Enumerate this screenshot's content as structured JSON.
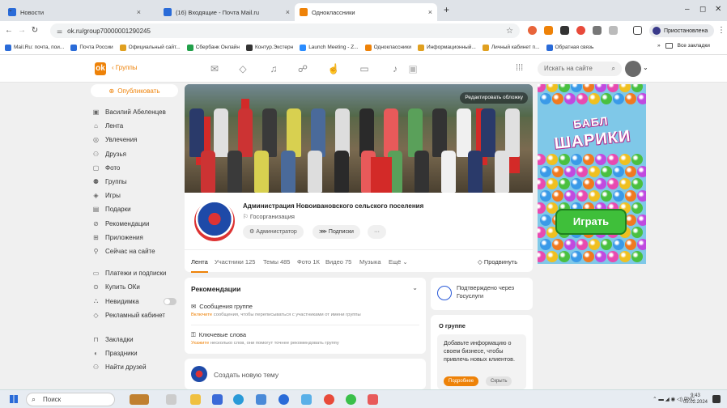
{
  "browser": {
    "tabs": [
      {
        "title": "Новости",
        "color": "#2a6bd8"
      },
      {
        "title": "(16) Входящие - Почта Mail.ru",
        "color": "#2a6bd8"
      },
      {
        "title": "Одноклассники",
        "color": "#ee8208"
      }
    ],
    "new_tab": "+",
    "url": "ok.ru/group70000001290245",
    "suspended_label": "Приостановлена",
    "bookmarks": [
      {
        "label": "Mail.Ru: почта, пои...",
        "color": "#2a6bd8"
      },
      {
        "label": "Почта России",
        "color": "#2a6bd8"
      },
      {
        "label": "Официальный сайт...",
        "color": "#e0a020"
      },
      {
        "label": "Сбербанк Онлайн",
        "color": "#22a04a"
      },
      {
        "label": "Контур.Экстерн",
        "color": "#333"
      },
      {
        "label": "Launch Meeting - Z...",
        "color": "#2a8cff"
      },
      {
        "label": "Одноклассники",
        "color": "#ee8208"
      },
      {
        "label": "Информационный...",
        "color": "#e0a020"
      },
      {
        "label": "Личный кабинет п...",
        "color": "#e0a020"
      },
      {
        "label": "Обратная связь",
        "color": "#2a6bd8"
      }
    ],
    "more_bookmarks": "»",
    "all_bookmarks": "Все закладки"
  },
  "ok_header": {
    "logo": "ok",
    "groups_link": "‹ Группы",
    "search_placeholder": "Искать на сайте"
  },
  "left_nav": {
    "publish": "Опубликовать",
    "items": [
      {
        "label": "Василий Абеленцев",
        "icon": "▣"
      },
      {
        "label": "Лента",
        "icon": "⌂"
      },
      {
        "label": "Увлечения",
        "icon": "◎"
      },
      {
        "label": "Друзья",
        "icon": "⚇"
      },
      {
        "label": "Фото",
        "icon": "▢"
      },
      {
        "label": "Группы",
        "icon": "⚉"
      },
      {
        "label": "Игры",
        "icon": "◈"
      },
      {
        "label": "Подарки",
        "icon": "▤"
      },
      {
        "label": "Рекомендации",
        "icon": "⊘"
      },
      {
        "label": "Приложения",
        "icon": "⊞"
      },
      {
        "label": "Сейчас на сайте",
        "icon": "⚲"
      }
    ],
    "items2": [
      {
        "label": "Платежи и подписки",
        "icon": "▭"
      },
      {
        "label": "Купить ОКи",
        "icon": "⊙"
      },
      {
        "label": "Невидимка",
        "icon": "⛬"
      },
      {
        "label": "Рекламный кабинет",
        "icon": "◇"
      }
    ],
    "items3": [
      {
        "label": "Закладки",
        "icon": "⊓"
      },
      {
        "label": "Праздники",
        "icon": "◐"
      },
      {
        "label": "Найти друзей",
        "icon": "⚇"
      }
    ]
  },
  "group": {
    "edit_cover": "Редактировать обложку",
    "name": "Администрация Новоивановского сельского поселения",
    "type": "Госорганизация",
    "admin_chip": "Администратор",
    "subscriptions_chip": "Подписки",
    "more_chip": "···",
    "tabs": [
      "Лента",
      "Участники 125",
      "Темы 485",
      "Фото 1К",
      "Видео 75",
      "Музыка",
      "Ещё ⌄"
    ],
    "promote": "Продвинуть"
  },
  "recommendations": {
    "title": "Рекомендации",
    "item1_title": "Сообщения группе",
    "item1_accent": "Включите",
    "item1_sub": " сообщения, чтобы переписываться с участниками от имени группы",
    "item2_title": "Ключевые слова",
    "item2_accent": "Укажите",
    "item2_sub": " несколько слов, они помогут точнее рекомендовать группу"
  },
  "create_topic": "Создать новую тему",
  "gosuslugi": "Подтверждено через Госуслуги",
  "about": {
    "title": "О группе",
    "text": "Добавьте информацию о своем бизнесе, чтобы привлечь новых клиентов.",
    "more_btn": "Подробнее",
    "hide_btn": "Скрыть"
  },
  "ad": {
    "title_line1": "БАБЛ",
    "title_line2": "ШАРИКИ",
    "play_button": "Играть"
  },
  "taskbar": {
    "search": "Поиск",
    "lang": "РУС",
    "time": "9:43",
    "date": "05.02.2024"
  },
  "colors": {
    "accent": "#ee8208"
  }
}
